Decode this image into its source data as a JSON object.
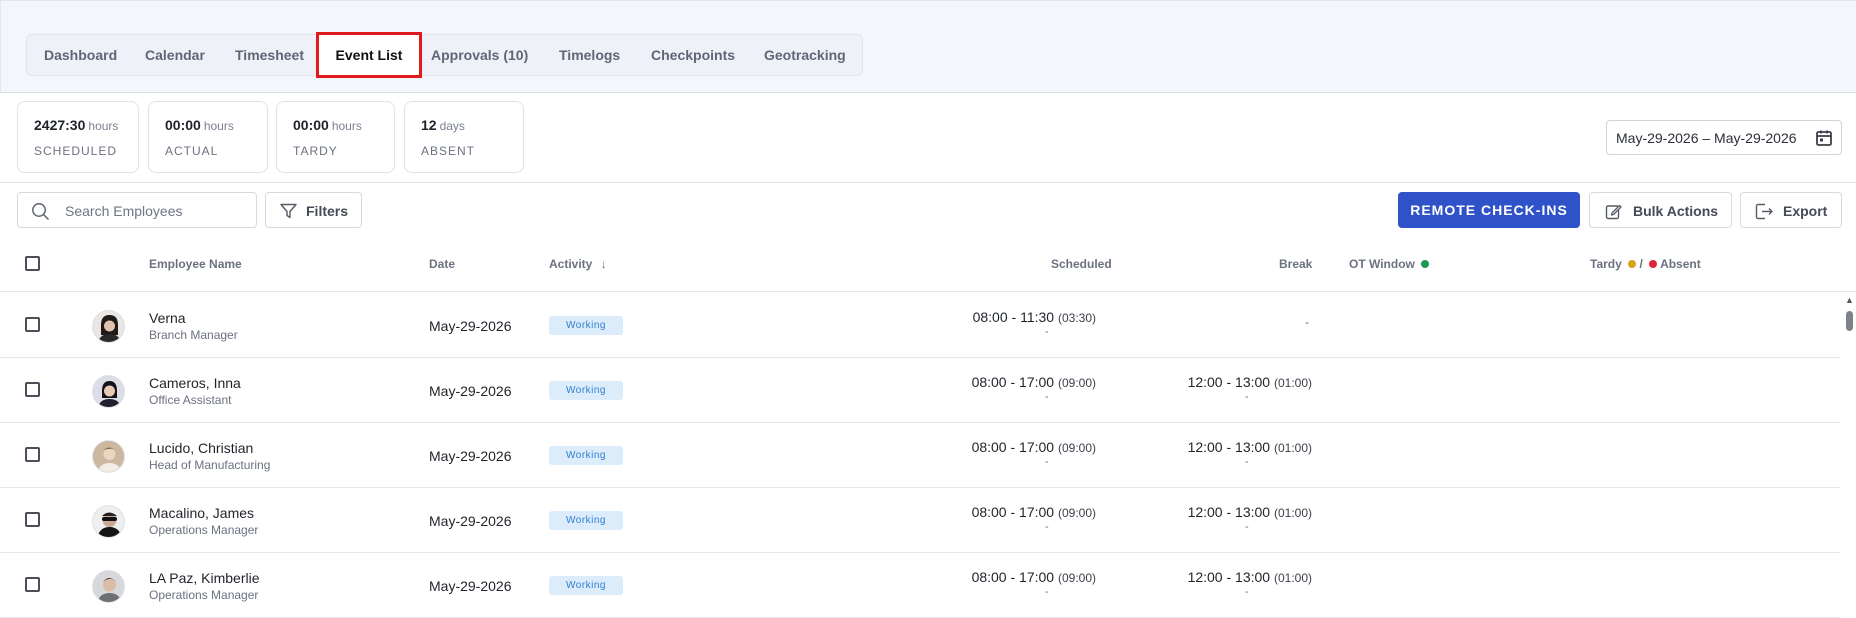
{
  "tabs": [
    {
      "label": "Dashboard"
    },
    {
      "label": "Calendar"
    },
    {
      "label": "Timesheet"
    },
    {
      "label": "Event List"
    },
    {
      "label": "Approvals (10)"
    },
    {
      "label": "Timelogs"
    },
    {
      "label": "Checkpoints"
    },
    {
      "label": "Geotracking"
    }
  ],
  "stats": [
    {
      "value": "2427:30",
      "unit": "hours",
      "label": "SCHEDULED"
    },
    {
      "value": "00:00",
      "unit": "hours",
      "label": "ACTUAL"
    },
    {
      "value": "00:00",
      "unit": "hours",
      "label": "TARDY"
    },
    {
      "value": "12",
      "unit": "days",
      "label": "ABSENT"
    }
  ],
  "date_range": "May-29-2026 – May-29-2026",
  "toolbar": {
    "search_placeholder": "Search Employees",
    "filters_label": "Filters",
    "remote_checkins_label": "REMOTE CHECK-INS",
    "bulk_actions_label": "Bulk Actions",
    "export_label": "Export"
  },
  "columns": {
    "employee_name": "Employee Name",
    "date": "Date",
    "activity": "Activity",
    "scheduled": "Scheduled",
    "break": "Break",
    "ot_window": "OT Window",
    "tardy": "Tardy",
    "slash": "/",
    "absent": "Absent"
  },
  "colors": {
    "ot_dot": "#1e9b4f",
    "tardy_dot": "#d9a21b",
    "absent_dot": "#e0243a",
    "primary": "#2f52c9",
    "active_tab_outline": "#e01b1b"
  },
  "rows": [
    {
      "name": "Verna",
      "role": "Branch Manager",
      "date": "May-29-2026",
      "activity": "Working",
      "scheduled": "08:00 - 11:30",
      "scheduled_dur": "(03:30)",
      "scheduled_sub": "-",
      "break": "-",
      "break_dur": "",
      "break_sub": ""
    },
    {
      "name": "Cameros, Inna",
      "role": "Office Assistant",
      "date": "May-29-2026",
      "activity": "Working",
      "scheduled": "08:00 - 17:00",
      "scheduled_dur": "(09:00)",
      "scheduled_sub": "-",
      "break": "12:00 - 13:00",
      "break_dur": "(01:00)",
      "break_sub": "-"
    },
    {
      "name": "Lucido, Christian",
      "role": "Head of Manufacturing",
      "date": "May-29-2026",
      "activity": "Working",
      "scheduled": "08:00 - 17:00",
      "scheduled_dur": "(09:00)",
      "scheduled_sub": "-",
      "break": "12:00 - 13:00",
      "break_dur": "(01:00)",
      "break_sub": "-"
    },
    {
      "name": "Macalino, James",
      "role": "Operations Manager",
      "date": "May-29-2026",
      "activity": "Working",
      "scheduled": "08:00 - 17:00",
      "scheduled_dur": "(09:00)",
      "scheduled_sub": "-",
      "break": "12:00 - 13:00",
      "break_dur": "(01:00)",
      "break_sub": "-"
    },
    {
      "name": "LA Paz, Kimberlie",
      "role": "Operations Manager",
      "date": "May-29-2026",
      "activity": "Working",
      "scheduled": "08:00 - 17:00",
      "scheduled_dur": "(09:00)",
      "scheduled_sub": "-",
      "break": "12:00 - 13:00",
      "break_dur": "(01:00)",
      "break_sub": "-"
    }
  ]
}
